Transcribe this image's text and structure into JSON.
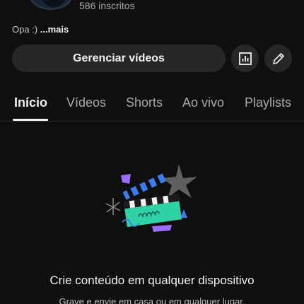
{
  "channel": {
    "subscribers": "586 inscritos",
    "description": "Opa :)",
    "more_label": "...mais"
  },
  "actions": {
    "manage_videos_label": "Gerenciar vídeos",
    "analytics_icon": "analytics-icon",
    "edit_icon": "pencil-icon"
  },
  "tabs": [
    {
      "label": "Início",
      "active": true
    },
    {
      "label": "Vídeos",
      "active": false
    },
    {
      "label": "Shorts",
      "active": false
    },
    {
      "label": "Ao vivo",
      "active": false
    },
    {
      "label": "Playlists",
      "active": false
    }
  ],
  "empty_state": {
    "illustration": "clapperboard-illustration",
    "title": "Crie conteúdo em qualquer dispositivo",
    "subtitle": "Grave e envie em casa ou em qualquer lugar."
  },
  "colors": {
    "background": "#0f0f0f",
    "button_bg": "#272727",
    "accent_teal": "#2fd1a6",
    "accent_blue": "#3d7cf0",
    "accent_purple": "#9b6cf5"
  }
}
